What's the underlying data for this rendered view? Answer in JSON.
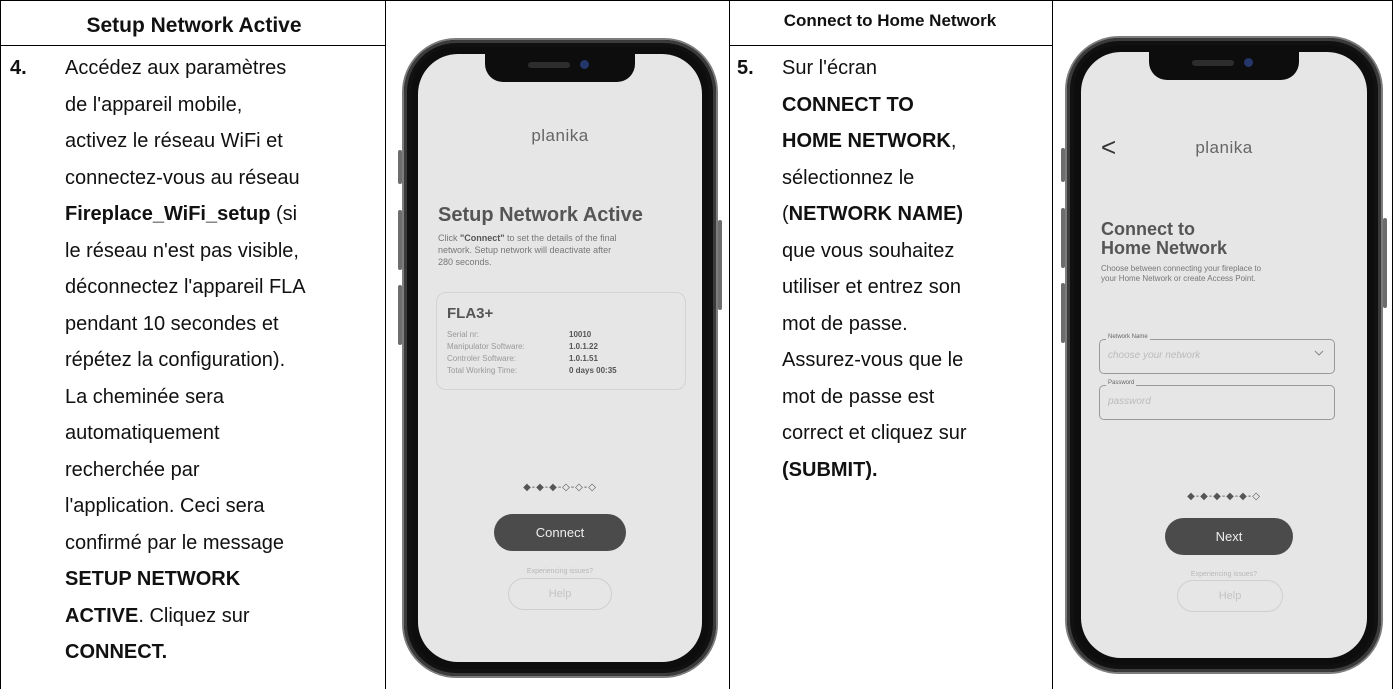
{
  "headers": {
    "left": "Setup Network Active",
    "right": "Connect to Home Network"
  },
  "step4": {
    "number": "4.",
    "lines": [
      "Accédez aux paramètres",
      "de l'appareil mobile,",
      "activez le réseau WiFi et",
      "connectez-vous au réseau",
      "Fireplace_WiFi_setup",
      " (si",
      "le réseau n'est pas visible,",
      "déconnectez l'appareil FLA",
      "pendant 10 secondes et",
      "répétez la configuration).",
      "La cheminée sera",
      "automatiquement",
      "recherchée par",
      "l'application. Ceci sera",
      "confirmé par le message",
      "SETUP NETWORK",
      "ACTIVE",
      ". Cliquez sur",
      "CONNECT."
    ]
  },
  "step5": {
    "number": "5.",
    "lines": [
      "Sur l'écran",
      "CONNECT TO",
      "HOME NETWORK",
      ",",
      "sélectionnez le",
      "(",
      "NETWORK NAME)",
      "que vous souhaitez",
      "utiliser et entrez son",
      "mot de passe.",
      "Assurez-vous que le",
      "mot de passe est",
      "correct et cliquez sur",
      "(SUBMIT)."
    ]
  },
  "phone1": {
    "logo": "planika",
    "title": "Setup Network Active",
    "desc_bold": "\"Connect\"",
    "desc_pre": "Click ",
    "desc_post": " to set the details of the final",
    "desc_line2": "network. Setup network will deactivate after",
    "desc_line3": "280 seconds.",
    "device": {
      "name": "FLA3+",
      "rows": [
        {
          "label": "Serial nr:",
          "value": "10010"
        },
        {
          "label": "Manipulator Software:",
          "value": "1.0.1.22"
        },
        {
          "label": "Controler Software:",
          "value": "1.0.1.51"
        },
        {
          "label": "Total Working Time:",
          "value": "0 days  00:35"
        }
      ]
    },
    "progress": "◆-◆-◆-◇-◇-◇",
    "connect_button": "Connect",
    "issues": "Experiencing issues?",
    "help_button": "Help"
  },
  "phone2": {
    "logo": "planika",
    "back": "<",
    "title_line1": "Connect to",
    "title_line2": "Home Network",
    "desc_line1": "Choose between connecting your fireplace to",
    "desc_line2": "your Home Network or create Access Point.",
    "network_label": "Network Name",
    "network_placeholder": "choose your network",
    "password_label": "Password",
    "password_placeholder": "password",
    "progress": "◆-◆-◆-◆-◆-◇",
    "next_button": "Next",
    "issues": "Experiencing issues?",
    "help_button": "Help"
  }
}
